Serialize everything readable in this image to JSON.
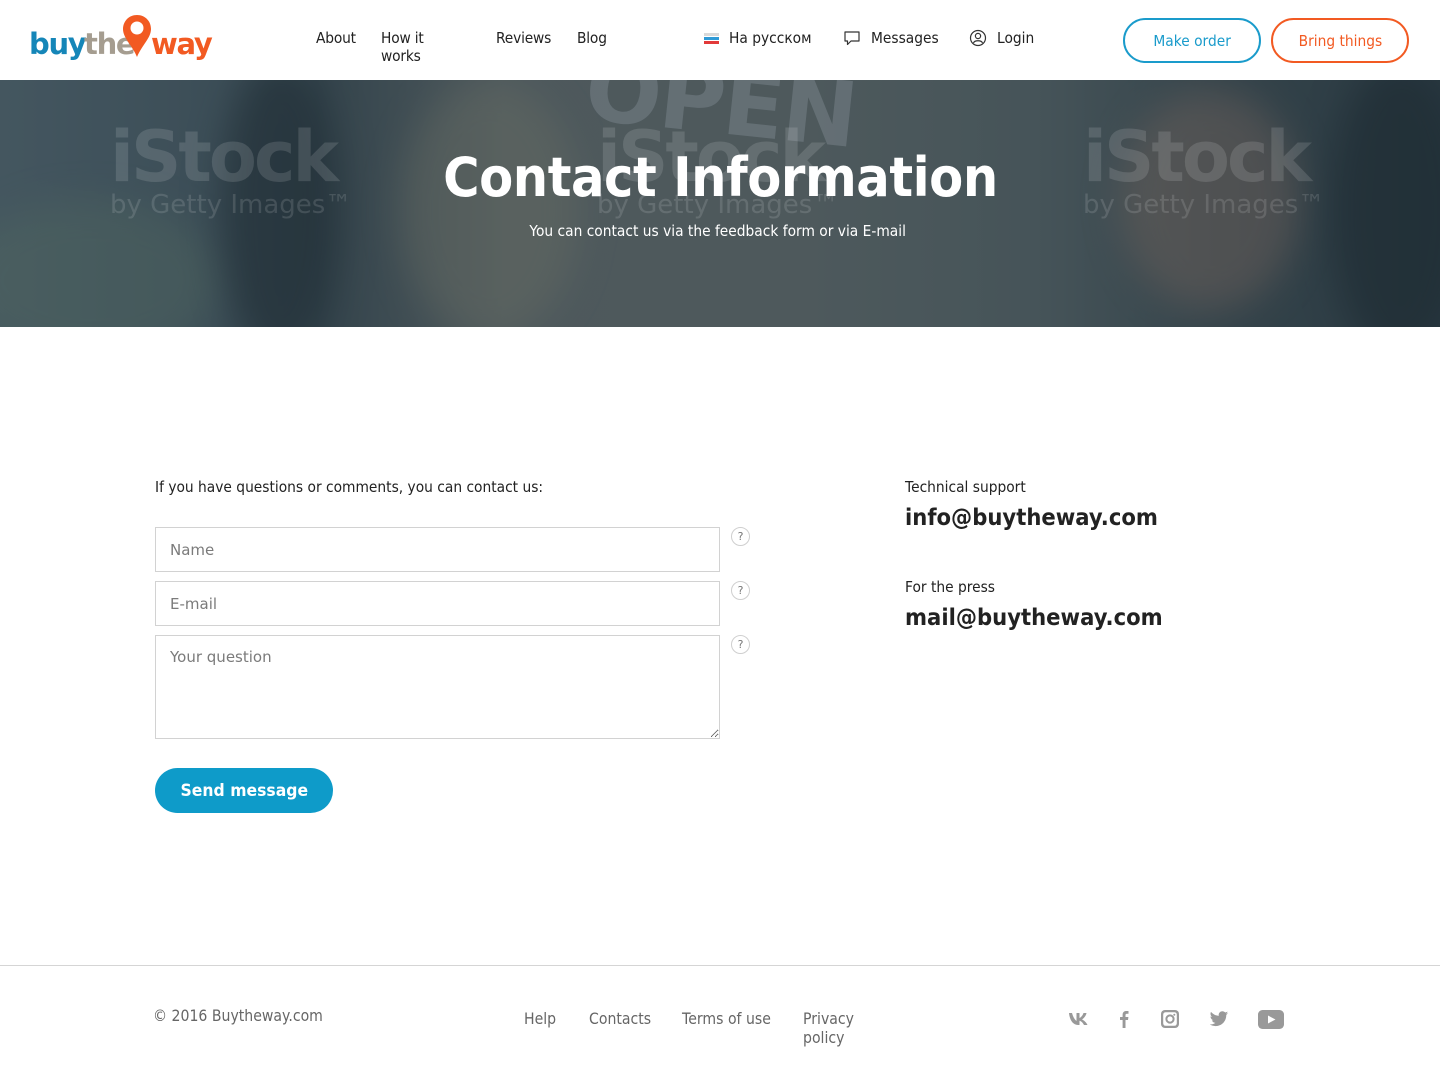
{
  "header": {
    "logo": {
      "part1": "buy",
      "part2": "the",
      "part3": "way"
    },
    "nav": [
      {
        "label": "About"
      },
      {
        "label": "How it works"
      },
      {
        "label": "Reviews"
      },
      {
        "label": "Blog"
      }
    ],
    "language": {
      "label": "На русском",
      "icon": "russian-flag-icon"
    },
    "messages": {
      "label": "Messages",
      "icon": "chat-bubble-icon"
    },
    "login": {
      "label": "Login",
      "icon": "user-circle-icon"
    },
    "make_order_label": "Make order",
    "bring_things_label": "Bring things",
    "colors": {
      "blue": "#1a9bcb",
      "orange": "#f25a22",
      "taupe": "#a59d90"
    }
  },
  "hero": {
    "title": "Contact Information",
    "subtitle": "You can contact us via the feedback form or via E-mail",
    "watermark_main": "iStock",
    "watermark_sub": "by Getty Images™",
    "sign_text": "OPEN"
  },
  "form": {
    "intro": "If you have questions or comments, you can contact us:",
    "name_placeholder": "Name",
    "email_placeholder": "E-mail",
    "question_placeholder": "Your question",
    "help_glyph": "?",
    "send_label": "Send message"
  },
  "contacts": {
    "support_label": "Technical support",
    "support_email": "info@buytheway.com",
    "press_label": "For the press",
    "press_email": "mail@buytheway.com"
  },
  "footer": {
    "copyright": "© 2016 Buytheway.com",
    "links": [
      {
        "label": "Help"
      },
      {
        "label": "Contacts"
      },
      {
        "label": "Terms of use"
      },
      {
        "label": "Privacy policy"
      }
    ],
    "social": [
      "vk-icon",
      "facebook-icon",
      "instagram-icon",
      "twitter-icon",
      "youtube-icon"
    ]
  }
}
